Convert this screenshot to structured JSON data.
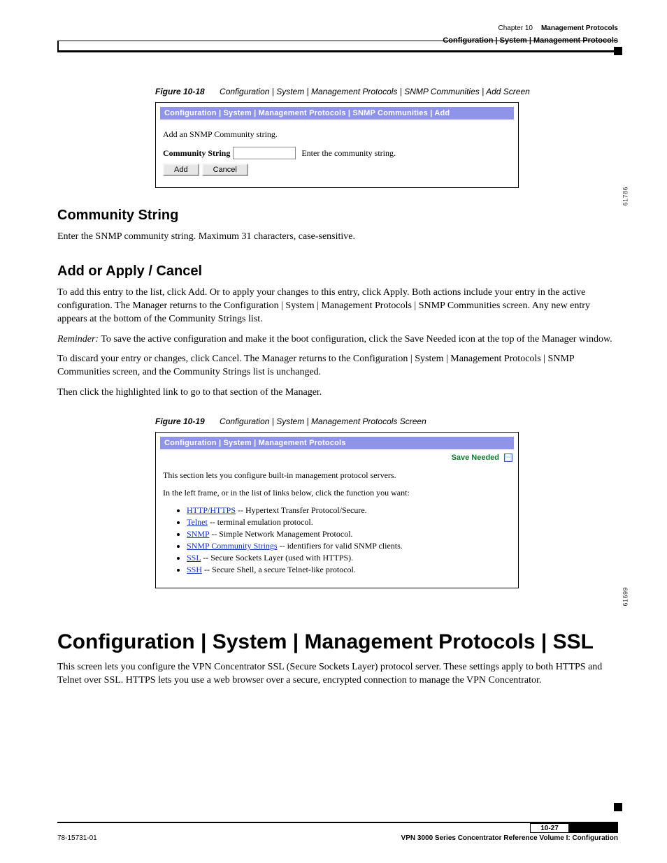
{
  "header": {
    "chapter_label": "Chapter 10",
    "chapter_title": "Management Protocols",
    "breadcrumb": "Configuration | System | Management Protocols"
  },
  "figure1": {
    "id": "Figure 10-18",
    "title": "Configuration | System | Management Protocols | SNMP Communities | Add Screen",
    "side_code": "61786",
    "screenshot": {
      "breadcrumb": "Configuration | System | Management Protocols | SNMP Communities | Add",
      "instruction": "Add an SNMP Community string.",
      "label": "Community String",
      "input_value": "",
      "hint": "Enter the community string.",
      "add_btn": "Add",
      "cancel_btn": "Cancel"
    }
  },
  "section_community": {
    "heading": "Community String",
    "body": "Enter the SNMP community string. Maximum 31 characters, case-sensitive."
  },
  "section_add_cancel": {
    "heading": "Add or Apply / Cancel",
    "p1": "To add this entry to the list, click Add. Or to apply your changes to this entry, click Apply. Both actions include your entry in the active configuration. The Manager returns to the Configuration | System | Management Protocols | SNMP Communities screen. Any new entry appears at the bottom of the Community Strings list.",
    "reminder_label": "Reminder:",
    "reminder_body": "To save the active configuration and make it the boot configuration, click the Save Needed icon at the top of the Manager window.",
    "p2": "To discard your entry or changes, click Cancel. The Manager returns to the Configuration | System | Management Protocols | SNMP Communities screen, and the Community Strings list is unchanged.",
    "p3": "Then click the highlighted link to go to that section of the Manager."
  },
  "figure2": {
    "id": "Figure 10-19",
    "title": "Configuration | System | Management Protocols Screen",
    "side_code": "61699",
    "screenshot": {
      "breadcrumb": "Configuration | System | Management Protocols",
      "save_needed": "Save Needed",
      "p1": "This section lets you configure built-in management protocol servers.",
      "p2": "In the left frame, or in the list of links below, click the function you want:",
      "items": [
        {
          "link": "HTTP/HTTPS",
          "desc": " -- Hypertext Transfer Protocol/Secure."
        },
        {
          "link": "Telnet",
          "desc": " -- terminal emulation protocol."
        },
        {
          "link": "SNMP",
          "desc": " -- Simple Network Management Protocol."
        },
        {
          "link": "SNMP Community Strings",
          "desc": " -- identifiers for valid SNMP clients."
        },
        {
          "link": "SSL",
          "desc": " -- Secure Sockets Layer (used with HTTPS)."
        },
        {
          "link": "SSH",
          "desc": " -- Secure Shell, a secure Telnet-like protocol."
        }
      ]
    }
  },
  "ssl_heading": "Configuration | System | Management Protocols | SSL",
  "ssl_body": "This screen lets you configure the VPN Concentrator SSL (Secure Sockets Layer) protocol server. These settings apply to both HTTPS and Telnet over SSL. HTTPS lets you use a web browser over a secure, encrypted connection to manage the VPN Concentrator.",
  "footer": {
    "page_num": "10-27",
    "doc_title": "VPN 3000 Series Concentrator Reference Volume I: Configuration",
    "doc_code": "78-15731-01"
  }
}
